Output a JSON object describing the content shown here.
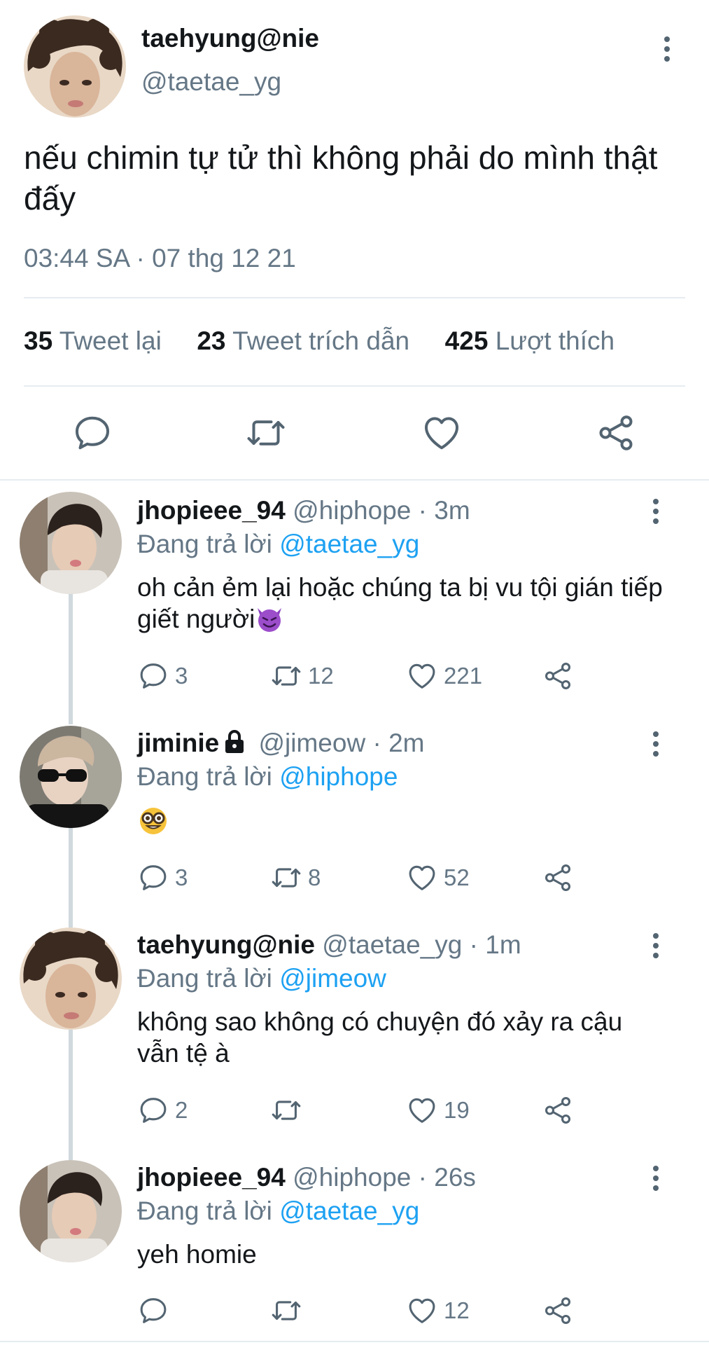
{
  "main_tweet": {
    "display_name": "taehyung@nie",
    "handle": "@taetae_yg",
    "text": "nếu chimin tự tử thì không phải do mình thật đấy",
    "timestamp": "03:44 SA · 07 thg 12 21",
    "stats": {
      "retweets_count": "35",
      "retweets_label": "Tweet lại",
      "quotes_count": "23",
      "quotes_label": "Tweet trích dẫn",
      "likes_count": "425",
      "likes_label": "Lượt thích"
    }
  },
  "replies": [
    {
      "display_name": "jhopieee_94",
      "handle_time": "@hiphope · 3m",
      "replying_prefix": "Đang trả lời",
      "replying_to": "@taetae_yg",
      "text": "oh cản ẻm lại hoặc chúng ta bị vu tội gián tiếp giết người",
      "emoji": "smiling-devil",
      "reply_count": "3",
      "retweet_count": "12",
      "like_count": "221",
      "avatar_color": "#b9b1a6",
      "locked": false
    },
    {
      "display_name": "jiminie",
      "handle_time": "@jimeow · 2m",
      "replying_prefix": "Đang trả lời",
      "replying_to": "@hiphope",
      "text": "",
      "emoji": "nerd-face",
      "reply_count": "3",
      "retweet_count": "8",
      "like_count": "52",
      "avatar_color": "#2a2a2a",
      "locked": true
    },
    {
      "display_name": "taehyung@nie",
      "handle_time": "@taetae_yg · 1m",
      "replying_prefix": "Đang trả lời",
      "replying_to": "@jimeow",
      "text": "không sao không có chuyện đó xảy ra cậu vẫn tệ à",
      "emoji": "",
      "reply_count": "2",
      "retweet_count": "",
      "like_count": "19",
      "avatar_color": "#7a5a44",
      "locked": false
    },
    {
      "display_name": "jhopieee_94",
      "handle_time": "@hiphope · 26s",
      "replying_prefix": "Đang trả lời",
      "replying_to": "@taetae_yg",
      "text": "yeh homie",
      "emoji": "",
      "reply_count": "",
      "retweet_count": "",
      "like_count": "12",
      "avatar_color": "#b9b1a6",
      "locked": false
    }
  ],
  "colors": {
    "text_primary": "#14171a",
    "text_secondary": "#657786",
    "mention": "#1da1f2",
    "divider": "#e6ecf0",
    "icon": "#536471"
  },
  "icons": {
    "reply": "reply-bubble-icon",
    "retweet": "retweet-icon",
    "like": "heart-icon",
    "share": "share-icon",
    "more": "more-vertical-icon",
    "lock": "lock-icon"
  }
}
